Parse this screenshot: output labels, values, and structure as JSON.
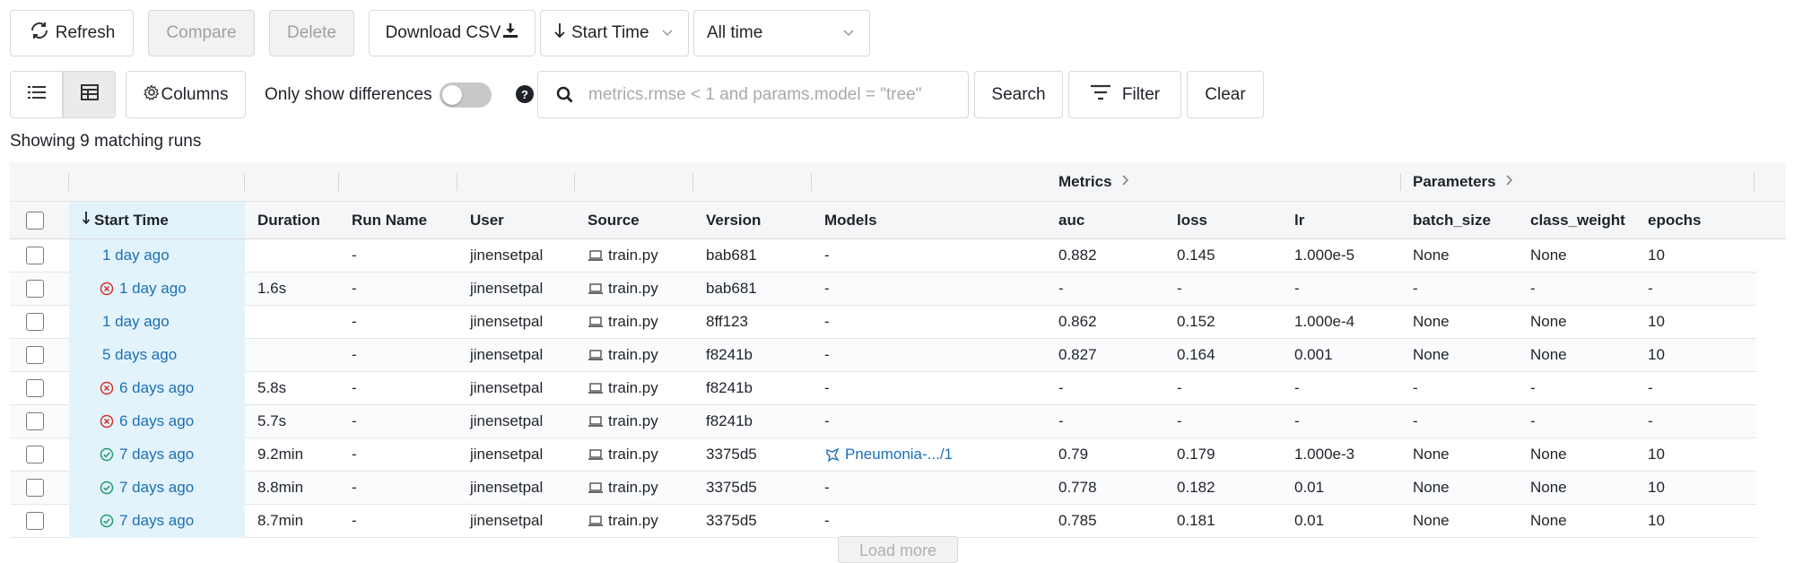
{
  "toolbar": {
    "refresh_label": "Refresh",
    "compare_label": "Compare",
    "delete_label": "Delete",
    "download_label": "Download CSV",
    "sort_label": "Start Time",
    "time_range_label": "All time"
  },
  "controls": {
    "columns_label": "Columns",
    "only_diff_label": "Only show differences",
    "only_diff_on": false,
    "search_placeholder": "metrics.rmse < 1 and params.model = \"tree\"",
    "search_label": "Search",
    "filter_label": "Filter",
    "clear_label": "Clear"
  },
  "summary": "Showing 9 matching runs",
  "groups": {
    "metrics": "Metrics",
    "parameters": "Parameters"
  },
  "columns": {
    "start_time": "Start Time",
    "duration": "Duration",
    "run_name": "Run Name",
    "user": "User",
    "source": "Source",
    "version": "Version",
    "models": "Models",
    "auc": "auc",
    "loss": "loss",
    "lr": "lr",
    "batch_size": "batch_size",
    "class_weight": "class_weight",
    "epochs": "epochs"
  },
  "rows": [
    {
      "status": "none",
      "start": "1 day ago",
      "duration": "",
      "run_name": "-",
      "user": "jinensetpal",
      "source": "train.py",
      "version": "bab681",
      "models": "-",
      "auc": "0.882",
      "loss": "0.145",
      "lr": "1.000e-5",
      "batch_size": "None",
      "class_weight": "None",
      "epochs": "10"
    },
    {
      "status": "failed",
      "start": "1 day ago",
      "duration": "1.6s",
      "run_name": "-",
      "user": "jinensetpal",
      "source": "train.py",
      "version": "bab681",
      "models": "-",
      "auc": "-",
      "loss": "-",
      "lr": "-",
      "batch_size": "-",
      "class_weight": "-",
      "epochs": "-"
    },
    {
      "status": "none",
      "start": "1 day ago",
      "duration": "",
      "run_name": "-",
      "user": "jinensetpal",
      "source": "train.py",
      "version": "8ff123",
      "models": "-",
      "auc": "0.862",
      "loss": "0.152",
      "lr": "1.000e-4",
      "batch_size": "None",
      "class_weight": "None",
      "epochs": "10"
    },
    {
      "status": "none",
      "start": "5 days ago",
      "duration": "",
      "run_name": "-",
      "user": "jinensetpal",
      "source": "train.py",
      "version": "f8241b",
      "models": "-",
      "auc": "0.827",
      "loss": "0.164",
      "lr": "0.001",
      "batch_size": "None",
      "class_weight": "None",
      "epochs": "10"
    },
    {
      "status": "failed",
      "start": "6 days ago",
      "duration": "5.8s",
      "run_name": "-",
      "user": "jinensetpal",
      "source": "train.py",
      "version": "f8241b",
      "models": "-",
      "auc": "-",
      "loss": "-",
      "lr": "-",
      "batch_size": "-",
      "class_weight": "-",
      "epochs": "-"
    },
    {
      "status": "failed",
      "start": "6 days ago",
      "duration": "5.7s",
      "run_name": "-",
      "user": "jinensetpal",
      "source": "train.py",
      "version": "f8241b",
      "models": "-",
      "auc": "-",
      "loss": "-",
      "lr": "-",
      "batch_size": "-",
      "class_weight": "-",
      "epochs": "-"
    },
    {
      "status": "finished",
      "start": "7 days ago",
      "duration": "9.2min",
      "run_name": "-",
      "user": "jinensetpal",
      "source": "train.py",
      "version": "3375d5",
      "models": "Pneumonia-.../1",
      "auc": "0.79",
      "loss": "0.179",
      "lr": "1.000e-3",
      "batch_size": "None",
      "class_weight": "None",
      "epochs": "10"
    },
    {
      "status": "finished",
      "start": "7 days ago",
      "duration": "8.8min",
      "run_name": "-",
      "user": "jinensetpal",
      "source": "train.py",
      "version": "3375d5",
      "models": "-",
      "auc": "0.778",
      "loss": "0.182",
      "lr": "0.01",
      "batch_size": "None",
      "class_weight": "None",
      "epochs": "10"
    },
    {
      "status": "finished",
      "start": "7 days ago",
      "duration": "8.7min",
      "run_name": "-",
      "user": "jinensetpal",
      "source": "train.py",
      "version": "3375d5",
      "models": "-",
      "auc": "0.785",
      "loss": "0.181",
      "lr": "0.01",
      "batch_size": "None",
      "class_weight": "None",
      "epochs": "10"
    }
  ],
  "load_more_label": "Load more",
  "colors": {
    "link": "#1c6fb5",
    "failed": "#d0312d",
    "finished": "#1d9a6c",
    "start_highlight": "#e3f3fb"
  }
}
